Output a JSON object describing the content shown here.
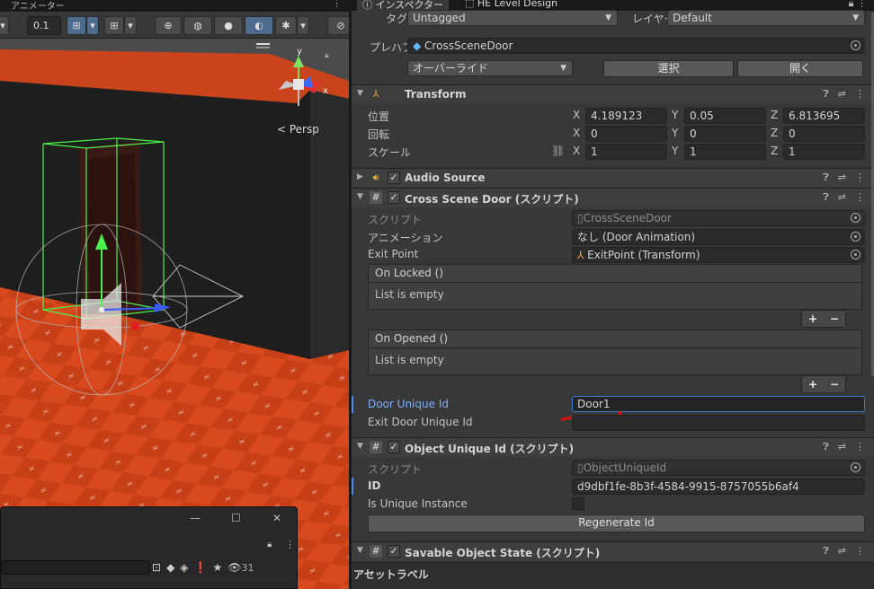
{
  "scene": {
    "tab_label": "アニメーター",
    "snap_value": "0.1",
    "persp_label": "< Persp",
    "axis_x": "x",
    "axis_y": "y"
  },
  "float_window": {
    "hidden_count": "31"
  },
  "inspector": {
    "tabs": [
      "インスペクター",
      "HE Level Design"
    ],
    "tag_label": "タグ",
    "tag_value": "Untagged",
    "layer_label": "レイヤー",
    "layer_value": "Default",
    "prefab_label": "プレハブ",
    "prefab_value": "CrossSceneDoor",
    "override_label": "オーバーライド",
    "select_label": "選択",
    "open_label": "開く",
    "transform": {
      "title": "Transform",
      "position_label": "位置",
      "rotation_label": "回転",
      "scale_label": "スケール",
      "position": {
        "x": "4.189123",
        "y": "0.05",
        "z": "6.813695"
      },
      "rotation": {
        "x": "0",
        "y": "0",
        "z": "0"
      },
      "scale": {
        "x": "1",
        "y": "1",
        "z": "1"
      }
    },
    "audio_source": {
      "title": "Audio Source"
    },
    "cross_scene_door": {
      "title": "Cross Scene Door (スクリプト)",
      "script_label": "スクリプト",
      "script_value": "CrossSceneDoor",
      "animation_label": "アニメーション",
      "animation_value": "なし (Door Animation)",
      "exit_point_label": "Exit Point",
      "exit_point_value": "ExitPoint (Transform)",
      "on_locked_label": "On Locked ()",
      "on_opened_label": "On Opened ()",
      "list_empty": "List is empty",
      "door_unique_id_label": "Door Unique Id",
      "door_unique_id_value": "Door1",
      "exit_door_unique_id_label": "Exit Door Unique Id",
      "exit_door_unique_id_value": ""
    },
    "object_unique_id": {
      "title": "Object Unique Id (スクリプト)",
      "script_label": "スクリプト",
      "script_value": "ObjectUniqueId",
      "id_label": "ID",
      "id_value": "d9dbf1fe-8b3f-4584-9915-8757055b6af4",
      "is_unique_label": "Is Unique Instance",
      "regenerate_label": "Regenerate Id"
    },
    "savable_object_state": {
      "title": "Savable Object State (スクリプト)"
    },
    "asset_label_title": "アセットラベル"
  },
  "colors": {
    "accent_blue": "#4a8cf0",
    "annotation_red": "#e01010",
    "floor_orange": "#d9451c",
    "selection_green": "#4cf04c"
  }
}
